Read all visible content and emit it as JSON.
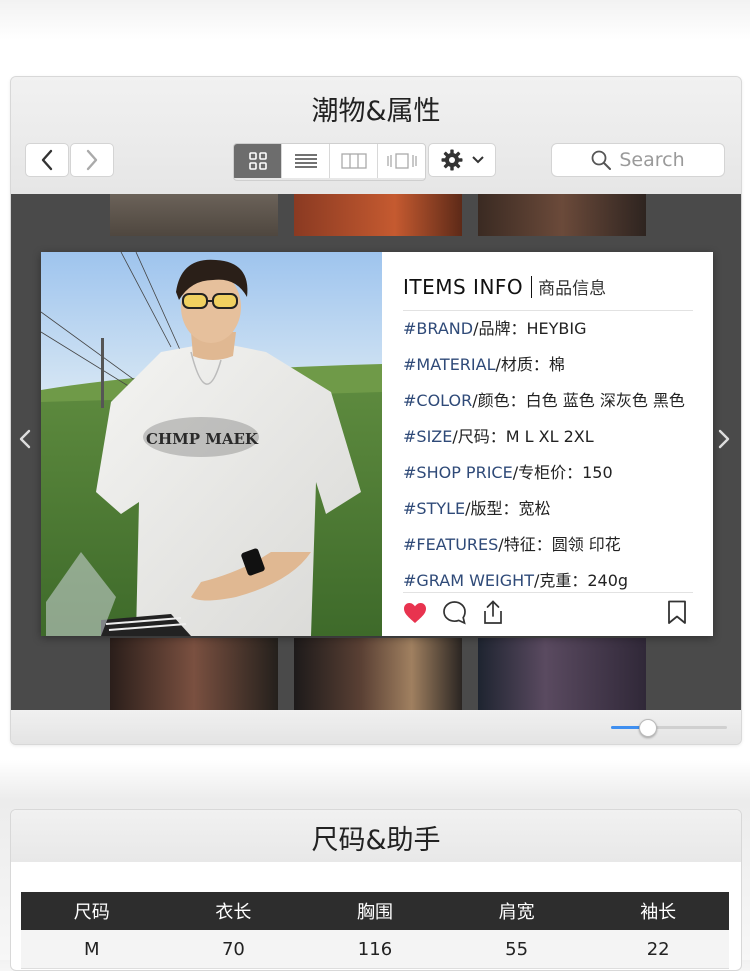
{
  "window1": {
    "title": "潮物&属性",
    "nav": {
      "back_icon": "chevron-left-icon",
      "forward_icon": "chevron-right-icon"
    },
    "view_modes": [
      {
        "icon": "grid-view-icon",
        "active": true
      },
      {
        "icon": "list-view-icon",
        "active": false
      },
      {
        "icon": "column-view-icon",
        "active": false
      },
      {
        "icon": "coverflow-view-icon",
        "active": false
      }
    ],
    "settings_icon": "gear-icon",
    "search": {
      "placeholder": "Search",
      "icon": "search-icon"
    },
    "product_card": {
      "photo_print_text": "CHMP MAEK",
      "title_en": "ITEMS INFO",
      "title_cn": "商品信息",
      "attributes": [
        {
          "key": "#BRAND",
          "label": "/品牌：",
          "value": "HEYBIG"
        },
        {
          "key": "#MATERIAL",
          "label": "/材质：",
          "value": "棉"
        },
        {
          "key": "#COLOR",
          "label": "/颜色：",
          "value": "白色 蓝色 深灰色 黑色"
        },
        {
          "key": "#SIZE",
          "label": "/尺码：",
          "value": "M L XL 2XL"
        },
        {
          "key": "#SHOP PRICE",
          "label": "/专柜价：",
          "value": "150"
        },
        {
          "key": "#STYLE",
          "label": "/版型：",
          "value": "宽松"
        },
        {
          "key": "#FEATURES",
          "label": "/特征：",
          "value": "圆领 印花"
        },
        {
          "key": "#GRAM WEIGHT",
          "label": "/克重：",
          "value": "240g"
        }
      ],
      "actions": [
        "heart-icon",
        "comment-icon",
        "share-icon",
        "bookmark-icon"
      ]
    },
    "slider_value": 0.31
  },
  "window2": {
    "title": "尺码&助手",
    "table": {
      "headers": [
        "尺码",
        "衣长",
        "胸围",
        "肩宽",
        "袖长"
      ],
      "rows": [
        [
          "M",
          "70",
          "116",
          "55",
          "22"
        ]
      ]
    }
  },
  "colors": {
    "heart": "#e8334f",
    "key_text": "#2f4a78",
    "slider_accent": "#3f8ff0",
    "table_header": "#2d2d2d"
  }
}
